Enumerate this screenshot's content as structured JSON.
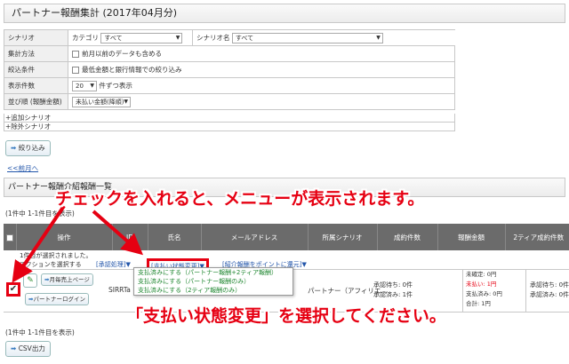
{
  "page_title": "パートナー報酬集計 (2017年04月分)",
  "filters": {
    "scenario": {
      "label": "シナリオ",
      "category_label": "カテゴリ",
      "category_value": "すべて",
      "name_label": "シナリオ名",
      "name_value": "すべて"
    },
    "aggregation": {
      "label": "集計方法",
      "option": "前月以前のデータも含める"
    },
    "narrow": {
      "label": "絞込条件",
      "option": "最低金額と銀行情報での絞り込み"
    },
    "count": {
      "label": "表示件数",
      "value": "20",
      "suffix": "件ずつ表示"
    },
    "sort": {
      "label": "並び順 (報酬金額)",
      "value": "未払い金額(降順)"
    },
    "add_scenario": "+追加シナリオ",
    "exclude_scenario": "+除外シナリオ"
  },
  "filter_button": "絞り込み",
  "prev_month": "<<前月へ",
  "section_title": "パートナー報酬介紹報酬一覧",
  "count_text_top": "(1件中 1-1件目を表示)",
  "count_text_bottom": "(1件中 1-1件目を表示)",
  "table": {
    "headers": [
      "操作",
      "ID",
      "氏名",
      "メールアドレス",
      "所属シナリオ",
      "成約件数",
      "報酬金額",
      "2ティア成約件数"
    ],
    "selected_note": "1件目が選択されました。",
    "select_action": "アクションを選択する",
    "approve_menu": "[承認処理]▼",
    "pay_status_menu": "[支払い状態変更]▼",
    "intro_menu": "[紹介報酬をポイントに還元]▼",
    "row": {
      "month_sales_button": "月毎売上ページ",
      "partner_login_button": "パートナーログイン",
      "id": "SIRRTa",
      "scenario": "パートナー（アフィリエ…",
      "approved_wait": "承認待ち: 0件",
      "approved_done": "承認済み: 1件",
      "reward_lines": [
        "未確定: 0円",
        "未払い: 1円",
        "支払済み: 0円",
        "合計: 1円"
      ],
      "tier_wait": "承認待ち: 0件",
      "tier_done": "承認済み: 0件"
    }
  },
  "dropdown_menu": [
    "支払済みにする（パートナー報酬+2ティア報酬）",
    "支払済みにする（パートナー報酬のみ）",
    "支払済みにする（2ティア報酬のみ）"
  ],
  "csv_button": "CSV出力",
  "annotations": {
    "top": "チェックを入れると、メニューが表示されます。",
    "bottom": "「支払い状態変更」を選択してください。"
  },
  "colors": {
    "annotation": "#e60012",
    "header_bg": "#6b6b6b",
    "menu_text": "#228833"
  }
}
